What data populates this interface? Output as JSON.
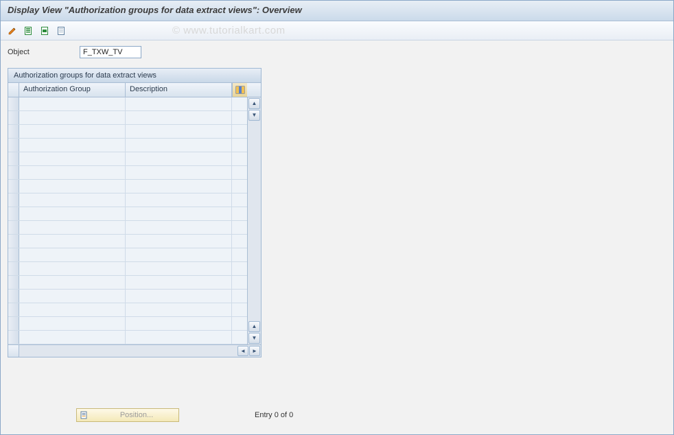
{
  "title": "Display View \"Authorization groups for data extract views\": Overview",
  "watermark": "© www.tutorialkart.com",
  "object_field": {
    "label": "Object",
    "value": "F_TXW_TV"
  },
  "table": {
    "title": "Authorization groups for data extract views",
    "columns": {
      "c1": "Authorization Group",
      "c2": "Description"
    },
    "rows": [
      {
        "auth_group": "",
        "description": ""
      },
      {
        "auth_group": "",
        "description": ""
      },
      {
        "auth_group": "",
        "description": ""
      },
      {
        "auth_group": "",
        "description": ""
      },
      {
        "auth_group": "",
        "description": ""
      },
      {
        "auth_group": "",
        "description": ""
      },
      {
        "auth_group": "",
        "description": ""
      },
      {
        "auth_group": "",
        "description": ""
      },
      {
        "auth_group": "",
        "description": ""
      },
      {
        "auth_group": "",
        "description": ""
      },
      {
        "auth_group": "",
        "description": ""
      },
      {
        "auth_group": "",
        "description": ""
      },
      {
        "auth_group": "",
        "description": ""
      },
      {
        "auth_group": "",
        "description": ""
      },
      {
        "auth_group": "",
        "description": ""
      },
      {
        "auth_group": "",
        "description": ""
      },
      {
        "auth_group": "",
        "description": ""
      },
      {
        "auth_group": "",
        "description": ""
      }
    ]
  },
  "position_button": "Position...",
  "entry_counter": "Entry 0 of 0",
  "icons": {
    "change": "change-display-icon",
    "select_all": "select-all-icon",
    "select_block": "select-block-icon",
    "deselect_all": "deselect-all-icon"
  }
}
